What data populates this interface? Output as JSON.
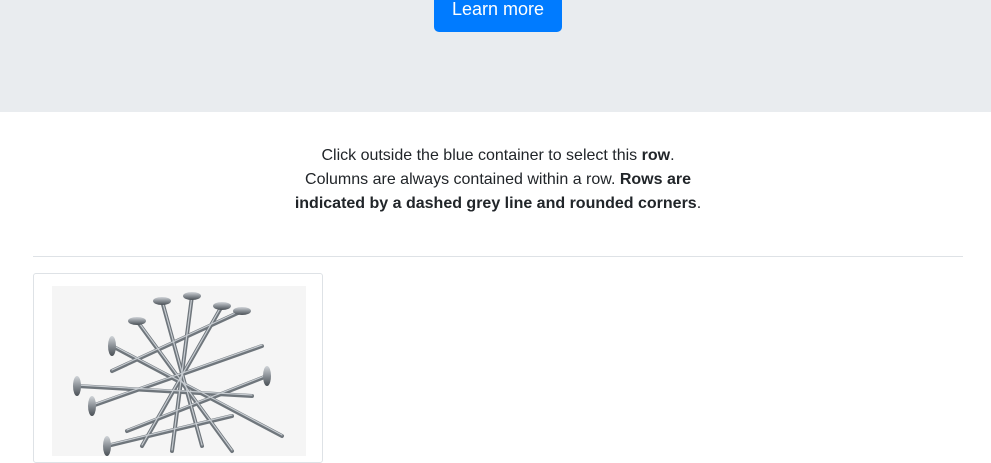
{
  "hero": {
    "button_label": "Learn more",
    "bg_color": "#e9ecef",
    "button_color": "#007bff"
  },
  "intro": {
    "line1_a": "Click outside the blue container to select this ",
    "line1_bold": "row",
    "line1_end": ".",
    "line2_a": "Columns are always contained within a row. ",
    "line2_bold": "Rows are indicated by a dashed grey line and rounded corners",
    "line2_end": "."
  },
  "card": {
    "image": "nails-photo"
  }
}
